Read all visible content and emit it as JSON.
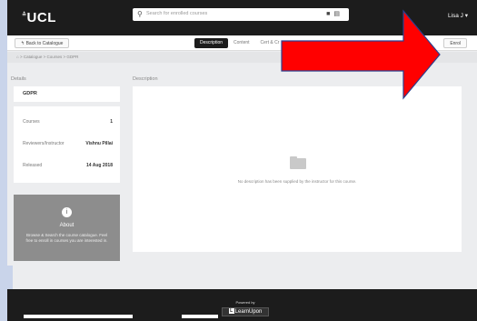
{
  "header": {
    "logo": "UCL",
    "logo_mark": "≛",
    "search_placeholder": "Search for enrolled courses",
    "user": "Lisa J ▾"
  },
  "subbar": {
    "back": "↰ Back to Catalogue",
    "tabs": [
      "Description",
      "Content",
      "Cert & Cr"
    ],
    "enrol": "Enrol"
  },
  "breadcrumb": "⌂  >  Catalogue  >  Courses  >  GDPR",
  "details": {
    "label": "Details",
    "course_title": "GDPR",
    "rows": [
      {
        "key": "Courses",
        "value": "1"
      },
      {
        "key": "Reviewers/Instructor",
        "value": "Vishnu Pillai"
      },
      {
        "key": "Released",
        "value": "14 Aug 2018"
      }
    ]
  },
  "about": {
    "title": "About",
    "text": "Browse & Search the course catalogue. Feel free to enroll in courses you are interested in."
  },
  "description": {
    "label": "Description",
    "empty_message": "No description has been supplied by the instructor for this course."
  },
  "footer": {
    "powered_by": "Powered by",
    "brand": "LearnUpon"
  },
  "colors": {
    "arrow": "#ff0000",
    "arrow_outline": "#2a3f8f",
    "header_bg": "#1c1c1c"
  }
}
